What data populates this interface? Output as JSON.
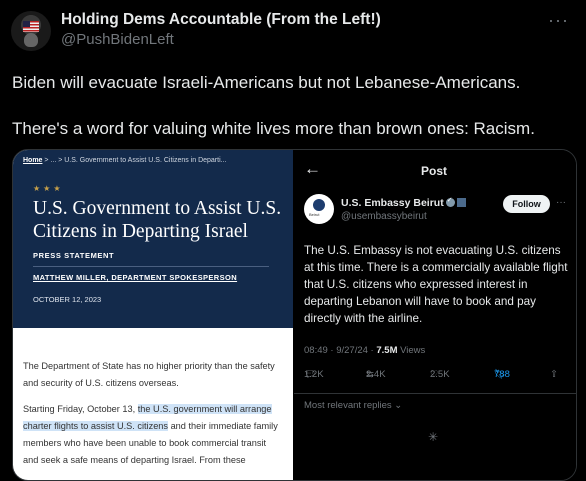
{
  "tweet": {
    "author_name": "Holding Dems Accountable (From the Left!)",
    "handle": "@PushBidenLeft",
    "more_icon": "···",
    "text_lines": [
      "Biden will evacuate Israeli-Americans but not Lebanese-Americans.",
      "There's a word for valuing white lives more than brown ones: Racism."
    ]
  },
  "left_panel": {
    "breadcrumb_home": "Home",
    "breadcrumb_rest": ">  ...  >  U.S. Government to Assist U.S. Citizens in Departi...",
    "stars": "★★★",
    "title": "U.S. Government to Assist U.S. Citizens in Departing Israel",
    "label": "PRESS STATEMENT",
    "author": "MATTHEW MILLER, DEPARTMENT SPOKESPERSON",
    "date": "OCTOBER 12, 2023",
    "para1": "The Department of State has no higher priority than the safety and security of U.S. citizens overseas.",
    "para2_pre": "Starting Friday, October 13, ",
    "para2_highlight": "the U.S. government will arrange charter flights to assist U.S. citizens",
    "para2_post": " and their immediate family members who have been unable to book commercial transit and seek a safe means of departing Israel. From these"
  },
  "right_panel": {
    "back_icon": "←",
    "header": "Post",
    "account_name": "U.S. Embassy Beirut",
    "avatar_label": "Beirut",
    "handle": "@usembassybeirut",
    "follow_label": "Follow",
    "more_icon": "···",
    "text": "The U.S. Embassy is not evacuating U.S. citizens at this time. There is a commercially available flight that U.S. citizens who expressed interest in departing Lebanon will have to book and pay directly with the airline.",
    "timestamp": "08:49 · 9/27/24 · ",
    "views_count": "7.5M",
    "views_label": " Views",
    "reply_count": "1.2K",
    "retweet_count": "2.4K",
    "like_count": "2.5K",
    "bookmark_count": "788",
    "more_replies": "Most relevant replies",
    "more_replies_icon": "⌄",
    "spinner_icon": "✳"
  },
  "colors": {
    "background": "#000000",
    "hero_navy": "#132a4b",
    "highlight": "#cfe3f7",
    "bookmark_blue": "#1d9bf0"
  }
}
